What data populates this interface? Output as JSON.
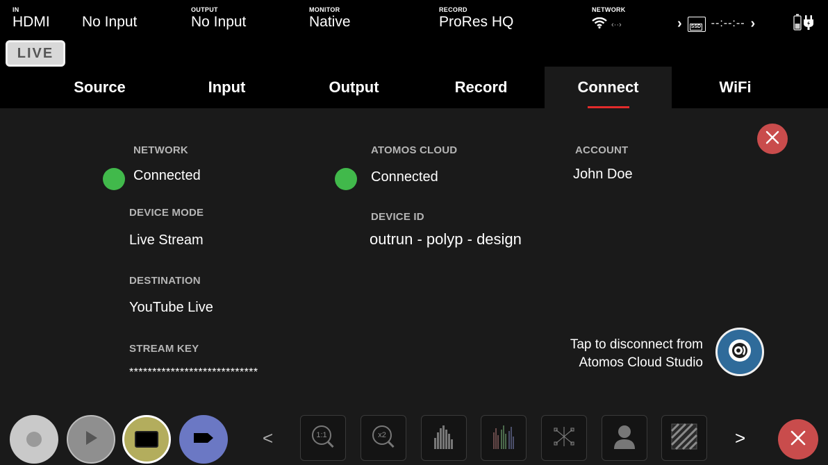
{
  "status_bar": {
    "input": {
      "label": "IN",
      "value": "HDMI"
    },
    "input_signal": {
      "value": "No Input"
    },
    "output": {
      "label": "OUTPUT",
      "value": "No Input"
    },
    "monitor": {
      "label": "MONITOR",
      "value": "Native"
    },
    "record": {
      "label": "RECORD",
      "value": "ProRes HQ"
    },
    "network": {
      "label": "NETWORK"
    },
    "media": {
      "drive": "SSD",
      "timecode": "--:--:--"
    }
  },
  "live_badge": "LIVE",
  "tabs": [
    {
      "label": "Source"
    },
    {
      "label": "Input"
    },
    {
      "label": "Output"
    },
    {
      "label": "Record"
    },
    {
      "label": "Connect",
      "active": true
    },
    {
      "label": "WiFi"
    }
  ],
  "connect": {
    "network": {
      "label": "NETWORK",
      "value": "Connected",
      "status_color": "#41b94b"
    },
    "device_mode": {
      "label": "DEVICE MODE",
      "value": "Live Stream"
    },
    "destination": {
      "label": "DESTINATION",
      "value": "YouTube Live"
    },
    "stream_key": {
      "label": "STREAM KEY",
      "value": "****************************"
    },
    "cloud": {
      "label": "ATOMOS CLOUD",
      "value": "Connected",
      "status_color": "#41b94b"
    },
    "device_id": {
      "label": "DEVICE ID",
      "value": "outrun - polyp - design"
    },
    "account": {
      "label": "ACCOUNT",
      "value": "John Doe"
    },
    "disconnect_line1": "Tap to disconnect from",
    "disconnect_line2": "Atomos Cloud Studio"
  },
  "bottom": {
    "prev_arrow": "<",
    "next_arrow": ">",
    "zoom_1_1": "1:1",
    "zoom_x2": "x2"
  },
  "colors": {
    "accent_red": "#e22b2b",
    "close_red": "#c94c4c",
    "connected_green": "#41b94b",
    "cloud_blue": "#2f6b9a",
    "monitor_btn": "#b3ad5d",
    "tag_btn": "#6b78c4"
  }
}
